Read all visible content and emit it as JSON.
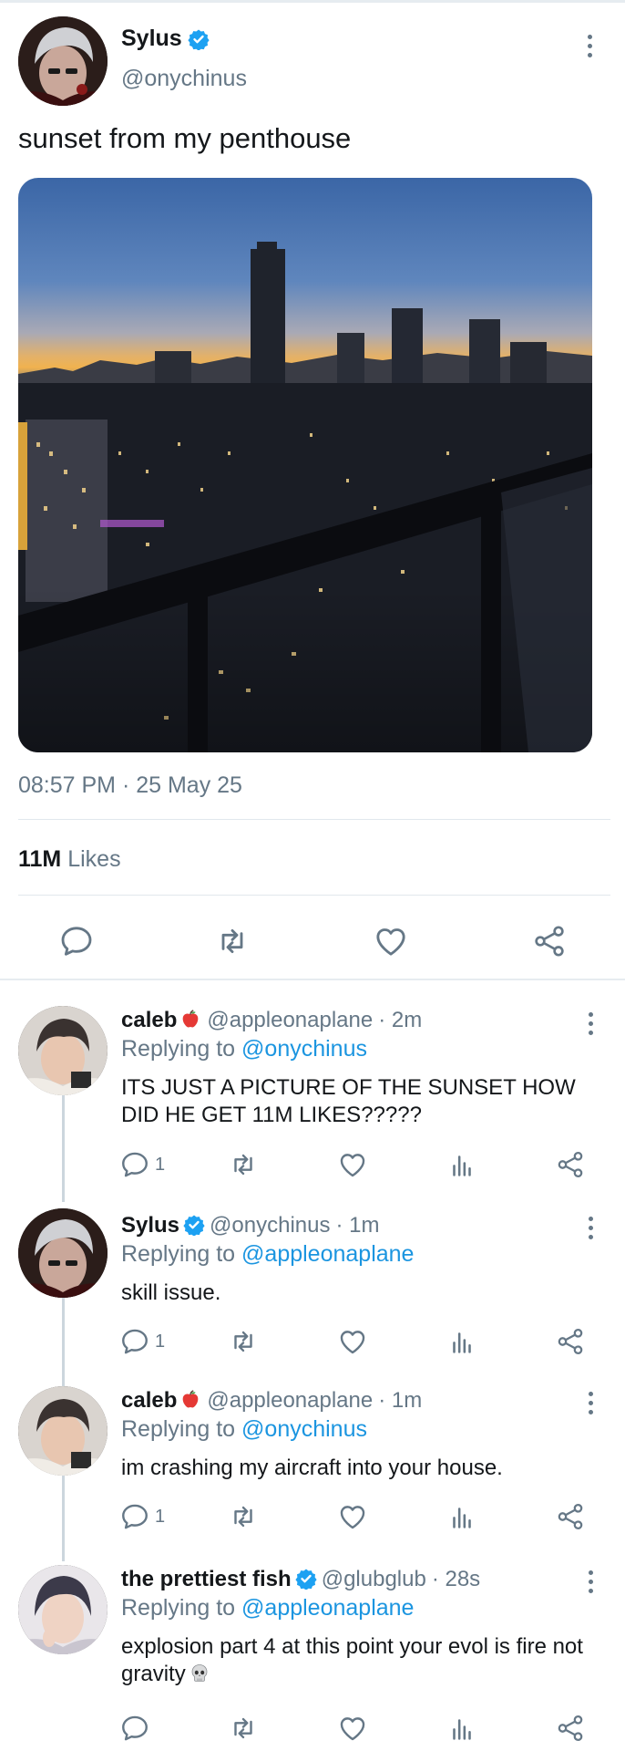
{
  "main_tweet": {
    "author_name": "Sylus",
    "handle": "@onychinus",
    "verified": true,
    "text": "sunset from my penthouse",
    "photo": "city skyline at sunset seen from a balcony",
    "timestamp": "08:57 PM · 25 May 25",
    "likes_count": "11M",
    "likes_label": "Likes",
    "actions": [
      "reply-icon",
      "retweet-icon",
      "like-icon",
      "share-icon"
    ]
  },
  "replies": [
    {
      "author_name": "caleb",
      "name_emoji": "apple-icon",
      "verified": false,
      "handle": "@appleonaplane",
      "time": "· 2m",
      "replying_prefix": "Replying to",
      "replying_to": "@onychinus",
      "text": "ITS JUST A PICTURE OF THE SUNSET HOW DID HE GET 11M LIKES?????",
      "reply_count": "1"
    },
    {
      "author_name": "Sylus",
      "verified": true,
      "handle": "@onychinus",
      "time": "· 1m",
      "replying_prefix": "Replying to",
      "replying_to": "@appleonaplane",
      "text": "skill issue.",
      "reply_count": "1"
    },
    {
      "author_name": "caleb",
      "name_emoji": "apple-icon",
      "verified": false,
      "handle": "@appleonaplane",
      "time": "· 1m",
      "replying_prefix": "Replying to",
      "replying_to": "@onychinus",
      "text": "im crashing my aircraft into your house.",
      "reply_count": "1"
    },
    {
      "author_name": "the prettiest fish",
      "verified": true,
      "handle": "@glubglub",
      "time": "· 28s",
      "replying_prefix": "Replying to",
      "replying_to": "@appleonaplane",
      "text": "explosion part 4 at this point your evol is fire not gravity",
      "text_emoji": "skull-icon",
      "reply_count": ""
    }
  ],
  "colors": {
    "text_primary": "#14171a",
    "text_secondary": "#657786",
    "link": "#1b95e0",
    "verified": "#1da1f2",
    "divider": "#e1e8ed",
    "icon": "#657786"
  }
}
